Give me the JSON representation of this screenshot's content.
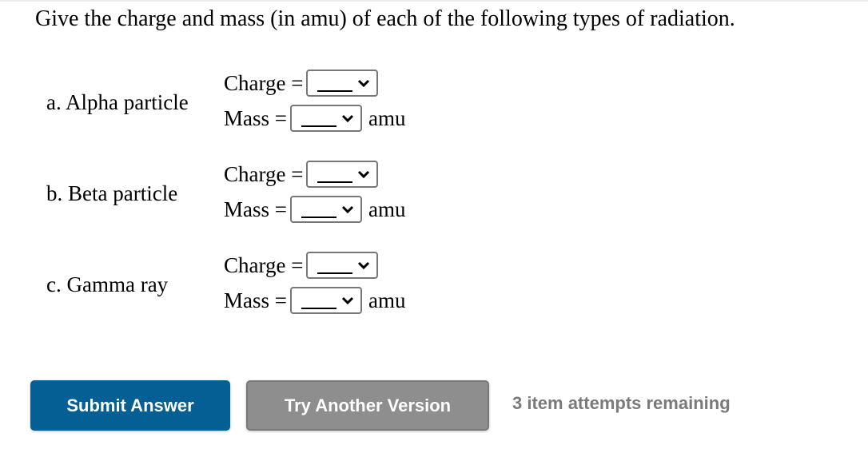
{
  "question": "Give the charge and mass (in amu) of each of the following types of radiation.",
  "items": [
    {
      "label": "a. Alpha particle",
      "charge_label": "Charge =",
      "mass_label": "Mass =",
      "charge_value": "",
      "mass_value": "",
      "unit": "amu"
    },
    {
      "label": "b. Beta particle",
      "charge_label": "Charge =",
      "mass_label": "Mass =",
      "charge_value": "",
      "mass_value": "",
      "unit": "amu"
    },
    {
      "label": "c. Gamma ray",
      "charge_label": "Charge =",
      "mass_label": "Mass =",
      "charge_value": "",
      "mass_value": "",
      "unit": "amu"
    }
  ],
  "buttons": {
    "submit": "Submit Answer",
    "try_another": "Try Another Version"
  },
  "attempts_text": "3 item attempts remaining",
  "colors": {
    "submit_bg": "#045f95",
    "try_bg": "#8e8e8e",
    "attempts_text": "#7a7a7a"
  }
}
